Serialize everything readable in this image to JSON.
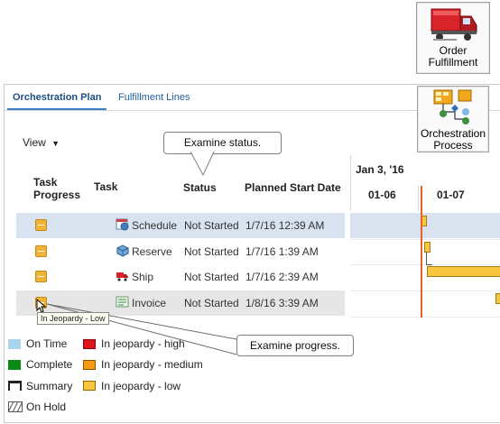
{
  "tiles": {
    "order_fulfillment": "Order\nFulfillment",
    "orchestration_process": "Orchestration\nProcess"
  },
  "tabs": [
    "Orchestration Plan",
    "Fulfillment Lines"
  ],
  "view_menu": "View",
  "callouts": {
    "status": "Examine status.",
    "progress": "Examine progress."
  },
  "columns": {
    "task_progress": "Task\nProgress",
    "task": "Task",
    "status": "Status",
    "planned_start": "Planned Start Date"
  },
  "gantt": {
    "week_label": "Jan 3, '16",
    "days": [
      "01-06",
      "01-07"
    ]
  },
  "rows": [
    {
      "task": "Schedule",
      "status": "Not Started",
      "planned_start": "1/7/16 12:39 AM",
      "icon": "schedule-icon"
    },
    {
      "task": "Reserve",
      "status": "Not Started",
      "planned_start": "1/7/16 1:39 AM",
      "icon": "reserve-icon"
    },
    {
      "task": "Ship",
      "status": "Not Started",
      "planned_start": "1/7/16 2:39 AM",
      "icon": "ship-icon"
    },
    {
      "task": "Invoice",
      "status": "Not Started",
      "planned_start": "1/8/16 3:39 AM",
      "icon": "invoice-icon"
    }
  ],
  "tooltip": "In Jeopardy - Low",
  "legend": {
    "on_time": "On Time",
    "complete": "Complete",
    "summary": "Summary",
    "on_hold": "On Hold",
    "high": "In jeopardy - high",
    "medium": "In jeopardy - medium",
    "low": "In jeopardy - low"
  },
  "colors": {
    "on_time": "#a9d6ee",
    "complete": "#0c8a16",
    "high": "#e0141b",
    "medium": "#f39b12",
    "low": "#f7c53e",
    "selected_row": "#d9e3f0",
    "today_line": "#e8632b"
  }
}
